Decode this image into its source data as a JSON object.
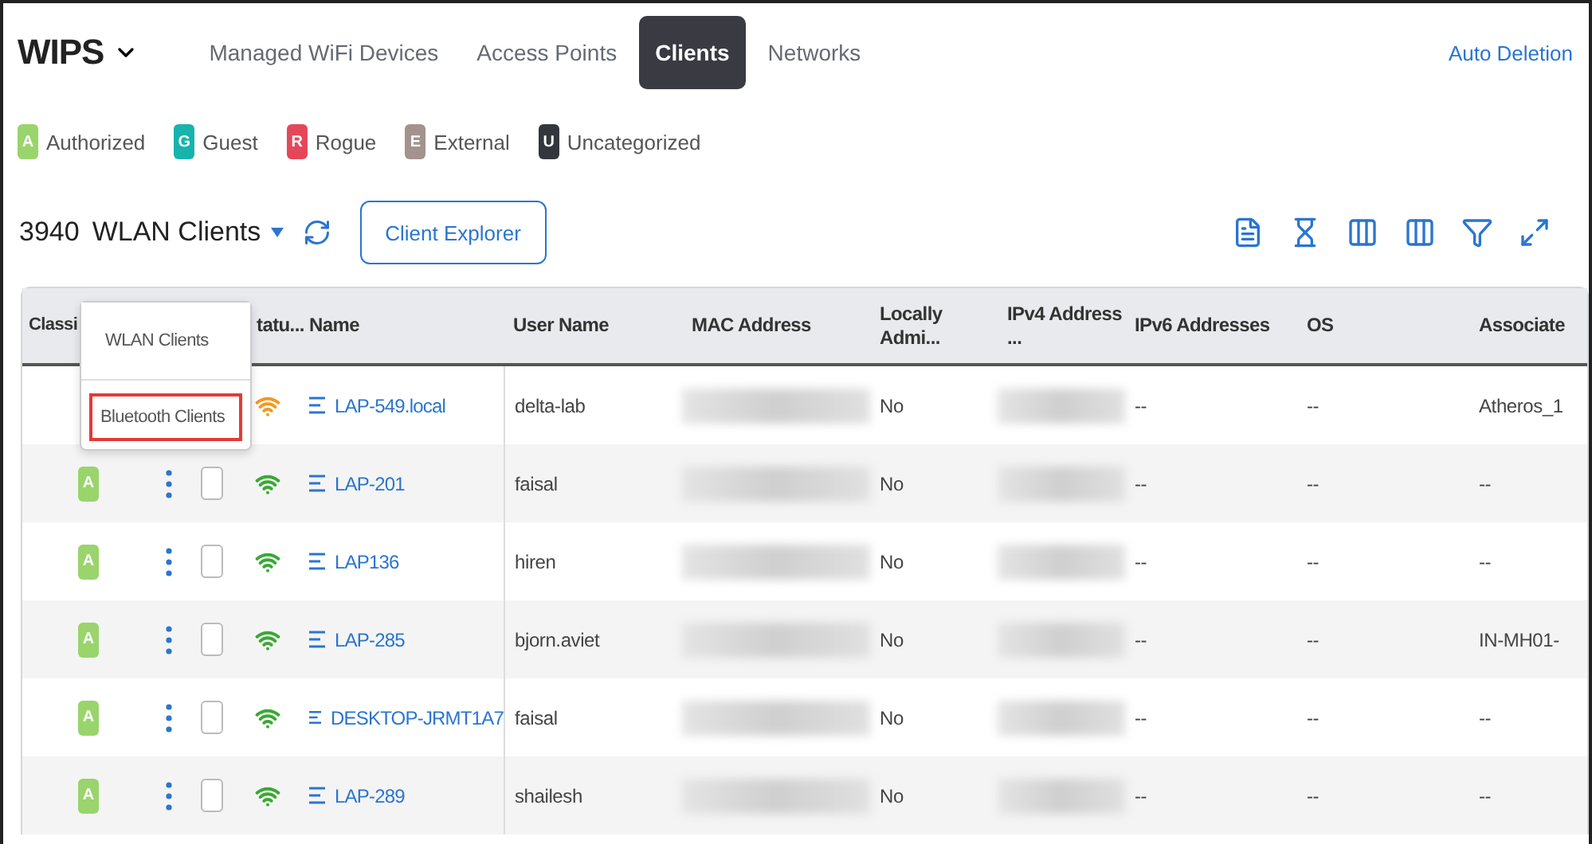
{
  "app": {
    "title": "WIPS"
  },
  "tabs": [
    {
      "label": "Managed WiFi Devices",
      "selected": false
    },
    {
      "label": "Access Points",
      "selected": false
    },
    {
      "label": "Clients",
      "selected": true
    },
    {
      "label": "Networks",
      "selected": false
    }
  ],
  "auto_deletion_link": "Auto Deletion",
  "legend": [
    {
      "letter": "A",
      "label": "Authorized",
      "color": "#9ad46c"
    },
    {
      "letter": "G",
      "label": "Guest",
      "color": "#17b3ad"
    },
    {
      "letter": "R",
      "label": "Rogue",
      "color": "#e5475a"
    },
    {
      "letter": "E",
      "label": "External",
      "color": "#a3928e"
    },
    {
      "letter": "U",
      "label": "Uncategorized",
      "color": "#34363d"
    }
  ],
  "toolbar": {
    "count": "3940",
    "view": "WLAN Clients",
    "explorer_button": "Client Explorer"
  },
  "view_menu": [
    {
      "label": "WLAN Clients",
      "highlighted": false
    },
    {
      "label": "Bluetooth Clients",
      "highlighted": true
    }
  ],
  "table": {
    "columns": [
      "Classi",
      "tatu...",
      "Name",
      "User Name",
      "MAC Address",
      "Locally Admi...",
      "IPv4 Address ...",
      "IPv6 Addresses",
      "OS",
      "Associate"
    ],
    "rows": [
      {
        "color": "#f29a1f",
        "name": "LAP-549.local",
        "user": "delta-lab",
        "locally_admin": "No",
        "ipv6": "--",
        "os": "--",
        "associated": "Atheros_1"
      },
      {
        "class": "A",
        "checked": false,
        "color": "#3aa935",
        "name": "LAP-201",
        "user": "faisal",
        "locally_admin": "No",
        "ipv6": "--",
        "os": "--",
        "associated": "--"
      },
      {
        "class": "A",
        "checked": false,
        "color": "#3aa935",
        "name": "LAP136",
        "user": "hiren",
        "locally_admin": "No",
        "ipv6": "--",
        "os": "--",
        "associated": "--"
      },
      {
        "class": "A",
        "checked": false,
        "color": "#3aa935",
        "name": "LAP-285",
        "user": "bjorn.aviet",
        "locally_admin": "No",
        "ipv6": "--",
        "os": "--",
        "associated": "IN-MH01-"
      },
      {
        "class": "A",
        "checked": false,
        "color": "#3aa935",
        "name": "DESKTOP-JRMT1A7",
        "user": "faisal",
        "locally_admin": "No",
        "ipv6": "--",
        "os": "--",
        "associated": "--"
      },
      {
        "class": "A",
        "checked": false,
        "color": "#3aa935",
        "name": "LAP-289",
        "user": "shailesh",
        "locally_admin": "No",
        "ipv6": "--",
        "os": "--",
        "associated": "--"
      }
    ]
  }
}
